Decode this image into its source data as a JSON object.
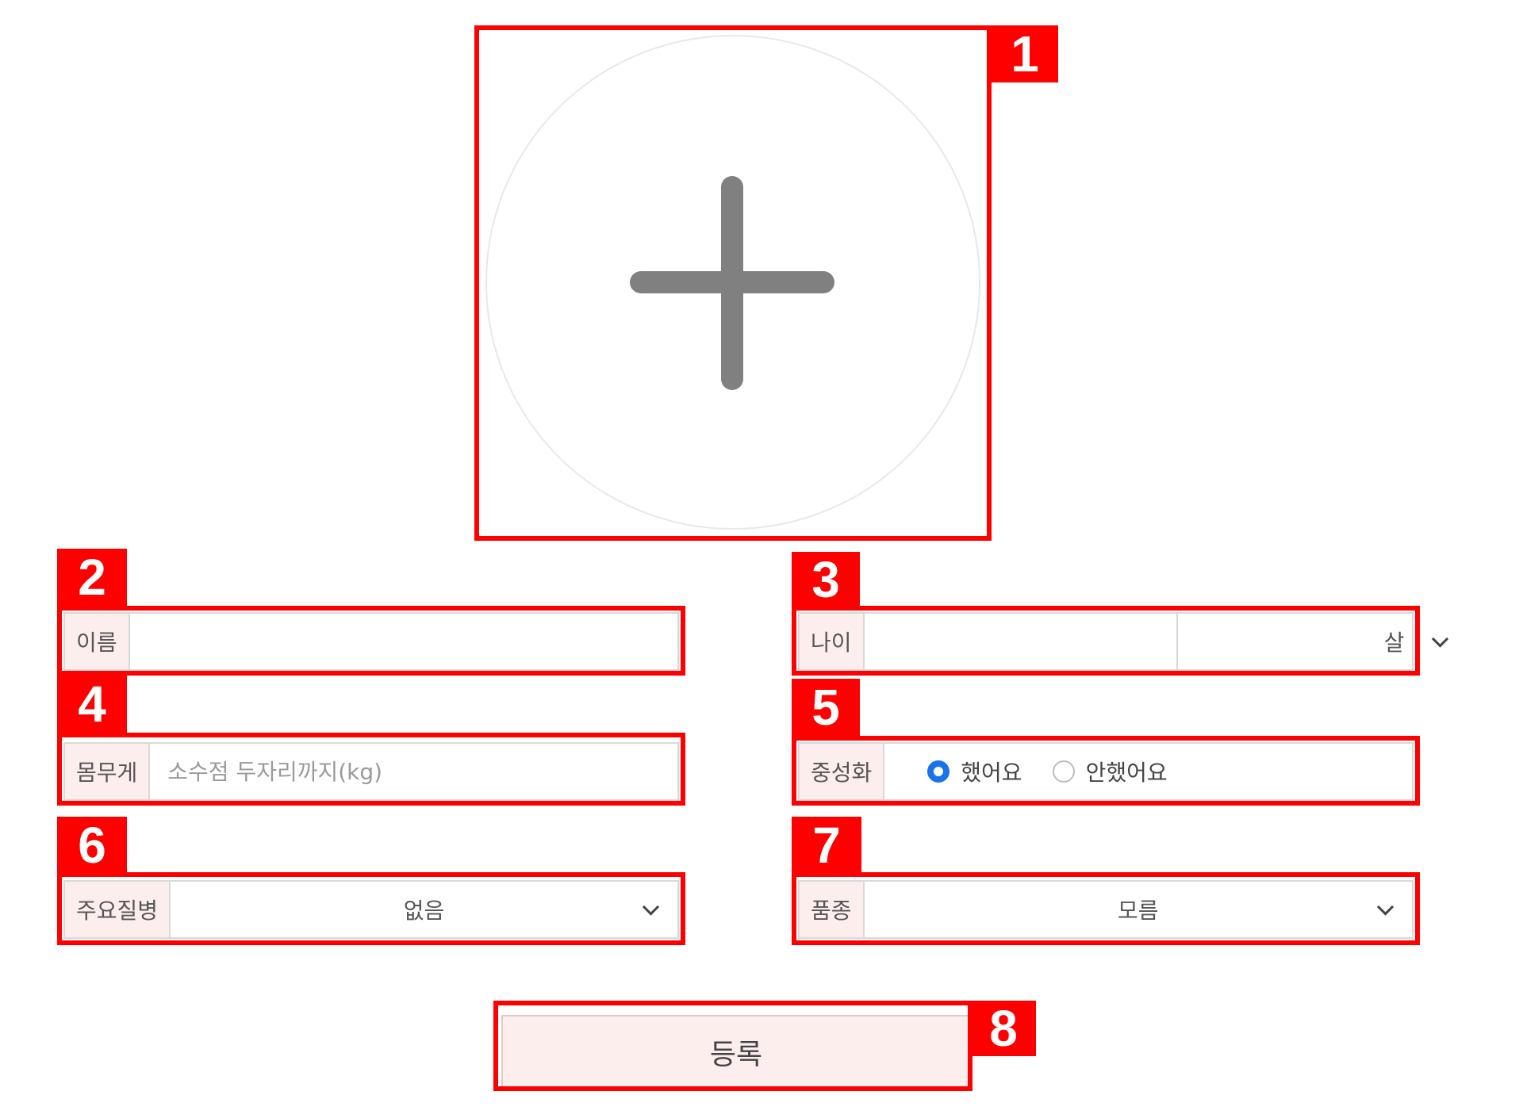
{
  "photo": {
    "add_icon": "plus-icon"
  },
  "fields": {
    "name": {
      "label": "이름",
      "value": ""
    },
    "age": {
      "label": "나이",
      "value": "",
      "unit": "살"
    },
    "weight": {
      "label": "몸무게",
      "value": "",
      "placeholder": "소수점 두자리까지(kg)"
    },
    "neutered": {
      "label": "중성화",
      "options": [
        "했어요",
        "안했어요"
      ],
      "selected": "했어요"
    },
    "disease": {
      "label": "주요질병",
      "selected": "없음"
    },
    "breed": {
      "label": "품종",
      "selected": "모름"
    }
  },
  "submit": {
    "label": "등록"
  },
  "annotations": [
    "1",
    "2",
    "3",
    "4",
    "5",
    "6",
    "7",
    "8"
  ],
  "colors": {
    "annotation": "#ff0000",
    "label_bg": "#fdeeee",
    "radio_checked": "#1a73e8",
    "plus": "#808080"
  }
}
